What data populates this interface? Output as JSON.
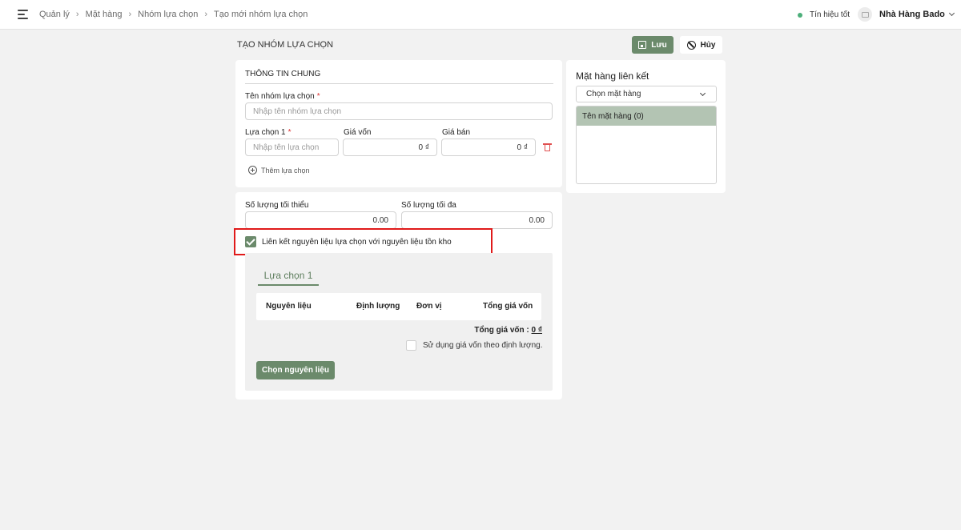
{
  "header": {
    "breadcrumb": [
      "Quản lý",
      "Mặt hàng",
      "Nhóm lựa chọn",
      "Tạo mới nhóm lựa chọn"
    ],
    "signal_text": "Tín hiệu tốt",
    "signal_color": "#4caf7a",
    "restaurant_name": "Nhà Hàng Bado"
  },
  "page": {
    "title": "TẠO NHÓM LỰA CHỌN",
    "save_label": "Lưu",
    "cancel_label": "Hủy",
    "accent_color": "#6b8a6b"
  },
  "general": {
    "section_title": "THÔNG TIN CHUNG",
    "group_name_label": "Tên nhóm lựa chọn",
    "required_mark": "*",
    "group_name_placeholder": "Nhập tên nhóm lựa chọn",
    "option_label": "Lựa chọn 1",
    "option_placeholder": "Nhập tên lựa chọn",
    "cost_label": "Giá vốn",
    "cost_value": "0 ₫",
    "price_label": "Giá bán",
    "price_value": "0 ₫",
    "add_option_label": "Thêm lựa chọn"
  },
  "quantity": {
    "min_label": "Số lượng tối thiểu",
    "min_value": "0.00",
    "max_label": "Số lượng tối đa",
    "max_value": "0.00",
    "link_checkbox_label": "Liên kết nguyên liệu lựa chọn với nguyên liệu tồn kho",
    "link_checked": true
  },
  "ingredients": {
    "tab_label": "Lựa chọn 1",
    "columns": [
      "Nguyên liệu",
      "Định lượng",
      "Đơn vị",
      "Tổng giá vốn"
    ],
    "total_label": "Tổng giá vốn :",
    "total_value": "0 ₫",
    "use_cost_label": "Sử dụng giá vốn theo định lượng.",
    "choose_button_label": "Chọn nguyên liệu"
  },
  "linked": {
    "title": "Mặt hàng liên kết",
    "select_placeholder": "Chọn mặt hàng",
    "list_header": "Tên mặt hàng (0)"
  }
}
